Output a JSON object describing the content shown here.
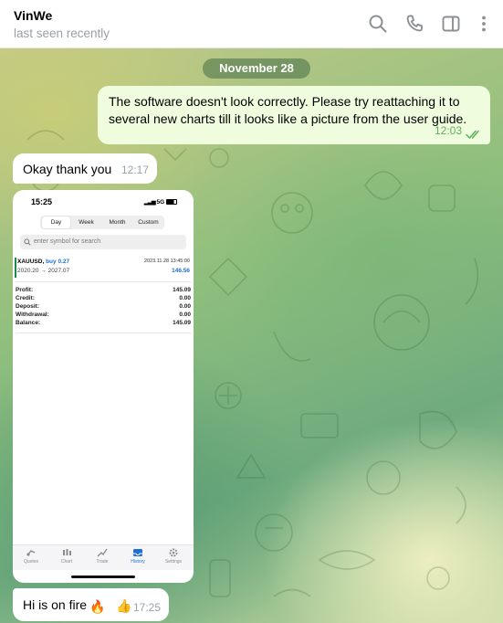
{
  "header": {
    "name": "VinWe",
    "status": "last seen recently",
    "icons": [
      "search-icon",
      "phone-icon",
      "sidebar-toggle-icon",
      "more-icon"
    ]
  },
  "date_separator": "November 28",
  "messages": [
    {
      "direction": "outgoing",
      "text": "The software doesn't look correctly. Please try reattaching it to several new charts till it looks like a picture from the user guide.",
      "time": "12:03",
      "status": "read"
    },
    {
      "direction": "incoming",
      "text": "Okay thank you",
      "time": "12:17"
    },
    {
      "direction": "incoming",
      "type": "image"
    },
    {
      "direction": "incoming",
      "text": "Hi is on fire",
      "emoji": "🔥",
      "reaction": "👍",
      "time": "17:25"
    }
  ],
  "screenshot": {
    "status_time": "15:25",
    "status_right": "5G",
    "segments": [
      {
        "label": "Day",
        "active": true
      },
      {
        "label": "Week",
        "active": false
      },
      {
        "label": "Month",
        "active": false
      },
      {
        "label": "Custom",
        "active": false
      }
    ],
    "search_placeholder": "enter symbol for search",
    "position": {
      "symbol": "XAUUSD,",
      "side": "buy 0.27",
      "prices": "2020.20 → 2027.07",
      "datetime": "2023.11.28 13:45:00",
      "profit": "146.56"
    },
    "summary": [
      {
        "label": "Profit:",
        "value": "145.09"
      },
      {
        "label": "Credit:",
        "value": "0.00"
      },
      {
        "label": "Deposit:",
        "value": "0.00"
      },
      {
        "label": "Withdrawal:",
        "value": "0.00"
      },
      {
        "label": "Balance:",
        "value": "145.09"
      }
    ],
    "tabs": [
      {
        "label": "Quotes",
        "icon": "quotes-icon"
      },
      {
        "label": "Chart",
        "icon": "chart-icon"
      },
      {
        "label": "Trade",
        "icon": "trade-icon"
      },
      {
        "label": "History",
        "icon": "history-icon",
        "active": true
      },
      {
        "label": "Settings",
        "icon": "settings-icon"
      }
    ]
  },
  "colors": {
    "outgoing_bubble": "#effdde",
    "incoming_bubble": "#ffffff",
    "time_outgoing": "#5fb05a",
    "accent_blue": "#1e6fd0"
  }
}
